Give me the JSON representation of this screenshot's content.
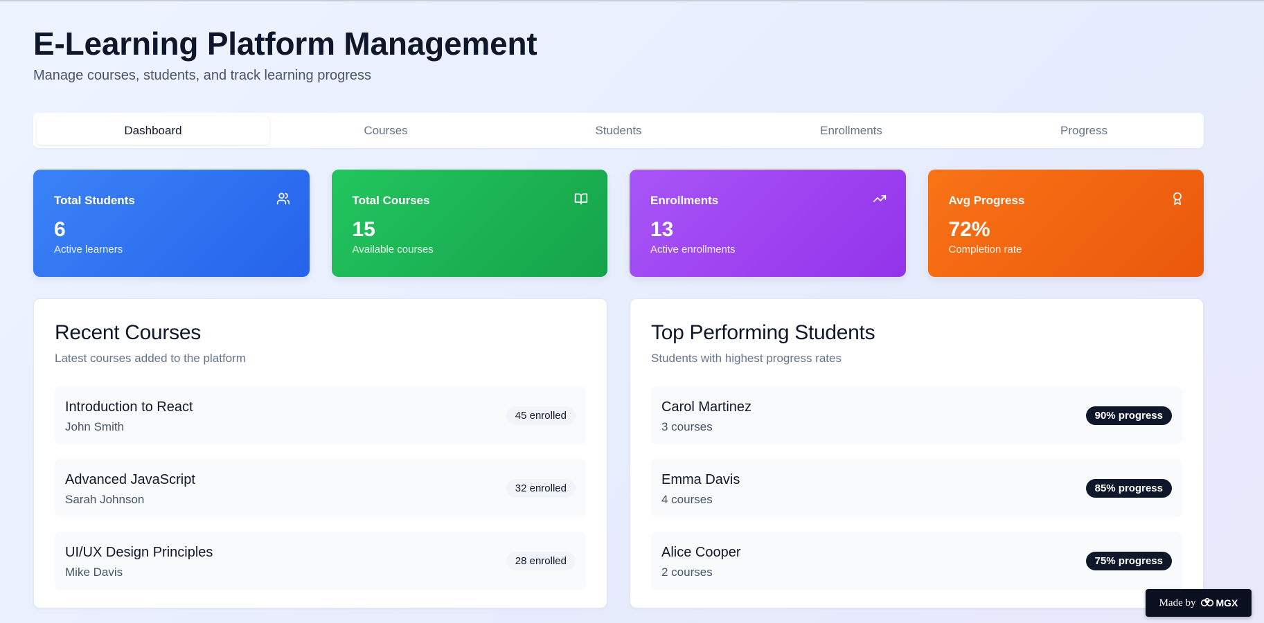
{
  "header": {
    "title": "E-Learning Platform Management",
    "subtitle": "Manage courses, students, and track learning progress"
  },
  "tabs": [
    {
      "label": "Dashboard",
      "active": true
    },
    {
      "label": "Courses",
      "active": false
    },
    {
      "label": "Students",
      "active": false
    },
    {
      "label": "Enrollments",
      "active": false
    },
    {
      "label": "Progress",
      "active": false
    }
  ],
  "stats": [
    {
      "label": "Total Students",
      "value": "6",
      "description": "Active learners",
      "icon": "users-icon",
      "color": "#3b82f6"
    },
    {
      "label": "Total Courses",
      "value": "15",
      "description": "Available courses",
      "icon": "book-open-icon",
      "color": "#22c55e"
    },
    {
      "label": "Enrollments",
      "value": "13",
      "description": "Active enrollments",
      "icon": "trending-up-icon",
      "color": "#a855f7"
    },
    {
      "label": "Avg Progress",
      "value": "72%",
      "description": "Completion rate",
      "icon": "award-icon",
      "color": "#f97316"
    }
  ],
  "recent_courses": {
    "title": "Recent Courses",
    "subtitle": "Latest courses added to the platform",
    "items": [
      {
        "name": "Introduction to React",
        "instructor": "John Smith",
        "enrolled": "45 enrolled"
      },
      {
        "name": "Advanced JavaScript",
        "instructor": "Sarah Johnson",
        "enrolled": "32 enrolled"
      },
      {
        "name": "UI/UX Design Principles",
        "instructor": "Mike Davis",
        "enrolled": "28 enrolled"
      }
    ]
  },
  "top_students": {
    "title": "Top Performing Students",
    "subtitle": "Students with highest progress rates",
    "items": [
      {
        "name": "Carol Martinez",
        "courses": "3 courses",
        "progress": "90% progress"
      },
      {
        "name": "Emma Davis",
        "courses": "4 courses",
        "progress": "85% progress"
      },
      {
        "name": "Alice Cooper",
        "courses": "2 courses",
        "progress": "75% progress"
      }
    ]
  },
  "badge": {
    "made_by": "Made by",
    "brand": "MGX",
    "icon": "mgx-logo-icon"
  }
}
